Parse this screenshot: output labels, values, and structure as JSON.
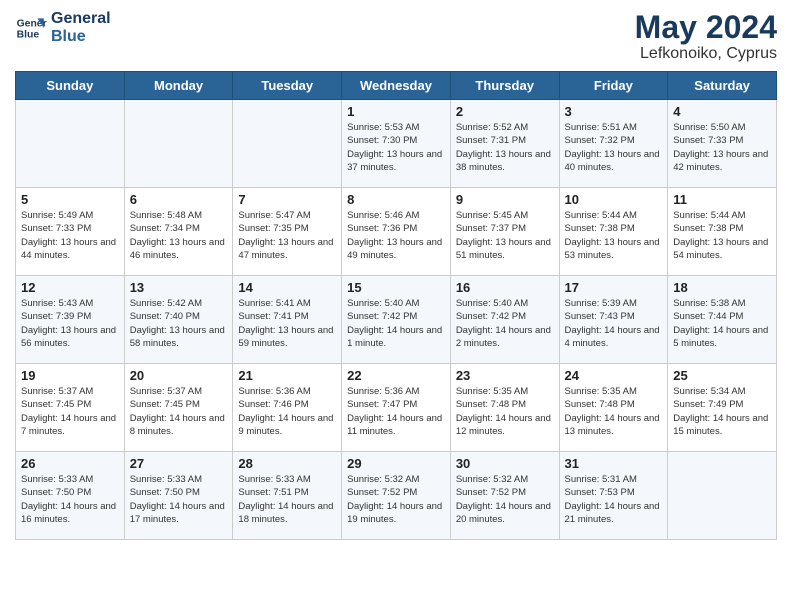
{
  "header": {
    "logo_line1": "General",
    "logo_line2": "Blue",
    "month_title": "May 2024",
    "location": "Lefkonoiko, Cyprus"
  },
  "weekdays": [
    "Sunday",
    "Monday",
    "Tuesday",
    "Wednesday",
    "Thursday",
    "Friday",
    "Saturday"
  ],
  "weeks": [
    [
      {
        "day": "",
        "info": ""
      },
      {
        "day": "",
        "info": ""
      },
      {
        "day": "",
        "info": ""
      },
      {
        "day": "1",
        "info": "Sunrise: 5:53 AM\nSunset: 7:30 PM\nDaylight: 13 hours\nand 37 minutes."
      },
      {
        "day": "2",
        "info": "Sunrise: 5:52 AM\nSunset: 7:31 PM\nDaylight: 13 hours\nand 38 minutes."
      },
      {
        "day": "3",
        "info": "Sunrise: 5:51 AM\nSunset: 7:32 PM\nDaylight: 13 hours\nand 40 minutes."
      },
      {
        "day": "4",
        "info": "Sunrise: 5:50 AM\nSunset: 7:33 PM\nDaylight: 13 hours\nand 42 minutes."
      }
    ],
    [
      {
        "day": "5",
        "info": "Sunrise: 5:49 AM\nSunset: 7:33 PM\nDaylight: 13 hours\nand 44 minutes."
      },
      {
        "day": "6",
        "info": "Sunrise: 5:48 AM\nSunset: 7:34 PM\nDaylight: 13 hours\nand 46 minutes."
      },
      {
        "day": "7",
        "info": "Sunrise: 5:47 AM\nSunset: 7:35 PM\nDaylight: 13 hours\nand 47 minutes."
      },
      {
        "day": "8",
        "info": "Sunrise: 5:46 AM\nSunset: 7:36 PM\nDaylight: 13 hours\nand 49 minutes."
      },
      {
        "day": "9",
        "info": "Sunrise: 5:45 AM\nSunset: 7:37 PM\nDaylight: 13 hours\nand 51 minutes."
      },
      {
        "day": "10",
        "info": "Sunrise: 5:44 AM\nSunset: 7:38 PM\nDaylight: 13 hours\nand 53 minutes."
      },
      {
        "day": "11",
        "info": "Sunrise: 5:44 AM\nSunset: 7:38 PM\nDaylight: 13 hours\nand 54 minutes."
      }
    ],
    [
      {
        "day": "12",
        "info": "Sunrise: 5:43 AM\nSunset: 7:39 PM\nDaylight: 13 hours\nand 56 minutes."
      },
      {
        "day": "13",
        "info": "Sunrise: 5:42 AM\nSunset: 7:40 PM\nDaylight: 13 hours\nand 58 minutes."
      },
      {
        "day": "14",
        "info": "Sunrise: 5:41 AM\nSunset: 7:41 PM\nDaylight: 13 hours\nand 59 minutes."
      },
      {
        "day": "15",
        "info": "Sunrise: 5:40 AM\nSunset: 7:42 PM\nDaylight: 14 hours\nand 1 minute."
      },
      {
        "day": "16",
        "info": "Sunrise: 5:40 AM\nSunset: 7:42 PM\nDaylight: 14 hours\nand 2 minutes."
      },
      {
        "day": "17",
        "info": "Sunrise: 5:39 AM\nSunset: 7:43 PM\nDaylight: 14 hours\nand 4 minutes."
      },
      {
        "day": "18",
        "info": "Sunrise: 5:38 AM\nSunset: 7:44 PM\nDaylight: 14 hours\nand 5 minutes."
      }
    ],
    [
      {
        "day": "19",
        "info": "Sunrise: 5:37 AM\nSunset: 7:45 PM\nDaylight: 14 hours\nand 7 minutes."
      },
      {
        "day": "20",
        "info": "Sunrise: 5:37 AM\nSunset: 7:45 PM\nDaylight: 14 hours\nand 8 minutes."
      },
      {
        "day": "21",
        "info": "Sunrise: 5:36 AM\nSunset: 7:46 PM\nDaylight: 14 hours\nand 9 minutes."
      },
      {
        "day": "22",
        "info": "Sunrise: 5:36 AM\nSunset: 7:47 PM\nDaylight: 14 hours\nand 11 minutes."
      },
      {
        "day": "23",
        "info": "Sunrise: 5:35 AM\nSunset: 7:48 PM\nDaylight: 14 hours\nand 12 minutes."
      },
      {
        "day": "24",
        "info": "Sunrise: 5:35 AM\nSunset: 7:48 PM\nDaylight: 14 hours\nand 13 minutes."
      },
      {
        "day": "25",
        "info": "Sunrise: 5:34 AM\nSunset: 7:49 PM\nDaylight: 14 hours\nand 15 minutes."
      }
    ],
    [
      {
        "day": "26",
        "info": "Sunrise: 5:33 AM\nSunset: 7:50 PM\nDaylight: 14 hours\nand 16 minutes."
      },
      {
        "day": "27",
        "info": "Sunrise: 5:33 AM\nSunset: 7:50 PM\nDaylight: 14 hours\nand 17 minutes."
      },
      {
        "day": "28",
        "info": "Sunrise: 5:33 AM\nSunset: 7:51 PM\nDaylight: 14 hours\nand 18 minutes."
      },
      {
        "day": "29",
        "info": "Sunrise: 5:32 AM\nSunset: 7:52 PM\nDaylight: 14 hours\nand 19 minutes."
      },
      {
        "day": "30",
        "info": "Sunrise: 5:32 AM\nSunset: 7:52 PM\nDaylight: 14 hours\nand 20 minutes."
      },
      {
        "day": "31",
        "info": "Sunrise: 5:31 AM\nSunset: 7:53 PM\nDaylight: 14 hours\nand 21 minutes."
      },
      {
        "day": "",
        "info": ""
      }
    ]
  ]
}
